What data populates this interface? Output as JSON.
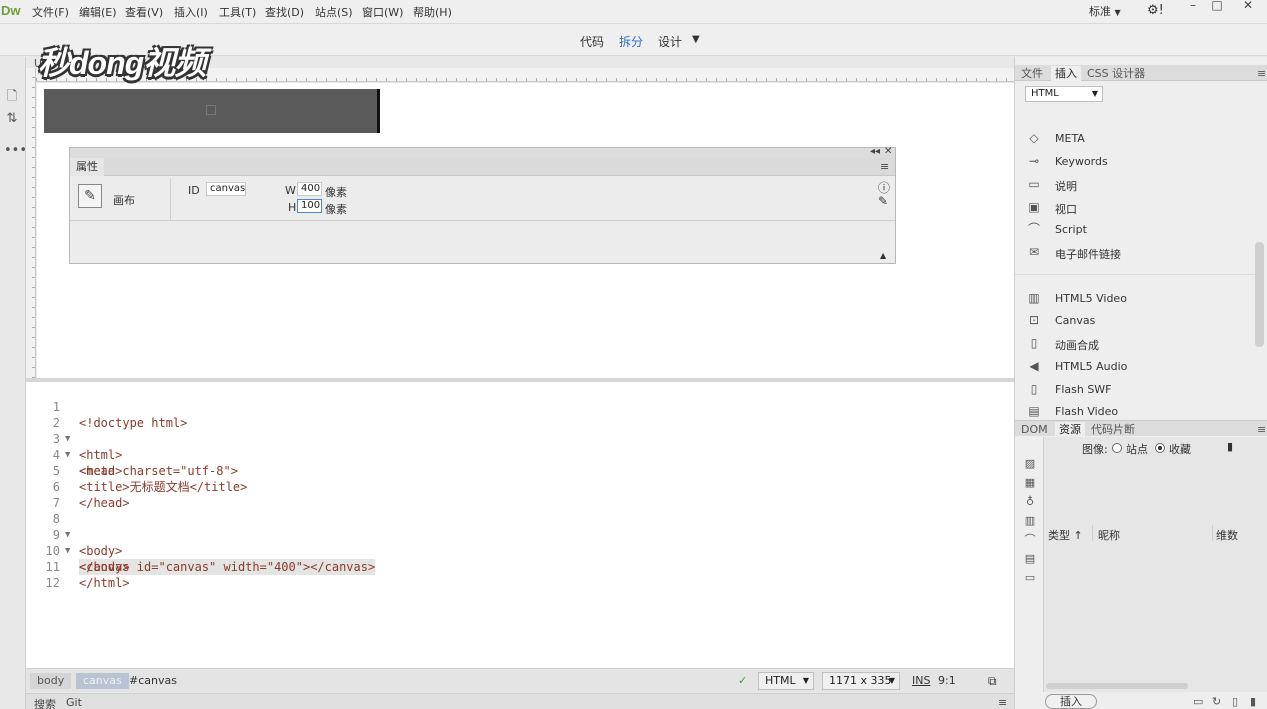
{
  "menubar": {
    "logo": "Dw",
    "items": [
      "文件(F)",
      "编辑(E)",
      "查看(V)",
      "插入(I)",
      "工具(T)",
      "查找(D)",
      "站点(S)",
      "窗口(W)",
      "帮助(H)"
    ],
    "workspace": "标准",
    "window_controls": [
      "minimize-icon",
      "maximize-icon",
      "close-icon"
    ]
  },
  "brand": "秒dong视频",
  "viewbar": {
    "code": "代码",
    "split": "拆分",
    "design": "设计",
    "active": "拆分"
  },
  "design": {
    "tab": "U"
  },
  "properties": {
    "tab": "属性",
    "element_name": "画布",
    "id_label": "ID",
    "id_value": "canvas",
    "w_label": "W",
    "w_value": "400",
    "w_unit": "像素",
    "h_label": "H",
    "h_value": "100",
    "h_unit": "像素"
  },
  "code": {
    "lines": [
      {
        "n": "1",
        "fold": "",
        "text": "<!doctype html>"
      },
      {
        "n": "2",
        "fold": "▼",
        "text": "<html>"
      },
      {
        "n": "3",
        "fold": "▼",
        "text": "<head>"
      },
      {
        "n": "4",
        "fold": "",
        "text": "<meta charset=\"utf-8\">"
      },
      {
        "n": "5",
        "fold": "",
        "text": "<title>无标题文档</title>"
      },
      {
        "n": "6",
        "fold": "",
        "text": "</head>"
      },
      {
        "n": "7",
        "fold": "",
        "text": ""
      },
      {
        "n": "8",
        "fold": "▼",
        "text": "<body>"
      },
      {
        "n": "9",
        "fold": "▼",
        "text": "<canvas id=\"canvas\" width=\"400\"></canvas>"
      },
      {
        "n": "10",
        "fold": "",
        "text": "</body>"
      },
      {
        "n": "11",
        "fold": "",
        "text": "</html>"
      },
      {
        "n": "12",
        "fold": "",
        "text": ""
      }
    ]
  },
  "statusbar": {
    "crumbs": [
      "body",
      "canvas",
      "#canvas"
    ],
    "doc_type": "HTML",
    "dimensions": "1171 x 335",
    "mode": "INS",
    "position": "9:1"
  },
  "bottombar": {
    "tabs": [
      "搜索",
      "Git"
    ]
  },
  "insert_panel": {
    "tabs": [
      "文件",
      "插入",
      "CSS 设计器"
    ],
    "active_tab": "插入",
    "category": "HTML",
    "items": [
      {
        "label": "META",
        "icon": "tag-icon"
      },
      {
        "label": "Keywords",
        "icon": "key-icon"
      },
      {
        "label": "说明",
        "icon": "comment-icon"
      },
      {
        "label": "视口",
        "icon": "monitor-icon"
      },
      {
        "label": "Script",
        "icon": "script-icon"
      },
      {
        "label": "电子邮件链接",
        "icon": "mail-icon"
      },
      {
        "label": "HTML5 Video",
        "icon": "film-icon"
      },
      {
        "label": "Canvas",
        "icon": "canvas-icon"
      },
      {
        "label": "动画合成",
        "icon": "document-icon"
      },
      {
        "label": "HTML5 Audio",
        "icon": "speaker-icon"
      },
      {
        "label": "Flash SWF",
        "icon": "flash-icon"
      },
      {
        "label": "Flash Video",
        "icon": "video-icon"
      }
    ]
  },
  "assets_panel": {
    "tabs": [
      "DOM",
      "资源",
      "代码片断"
    ],
    "active_tab": "资源",
    "images_label": "图像:",
    "radio_site": "站点",
    "radio_fav": "收藏",
    "columns": [
      "类型",
      "昵称",
      "维数"
    ],
    "insert_button": "插入"
  }
}
